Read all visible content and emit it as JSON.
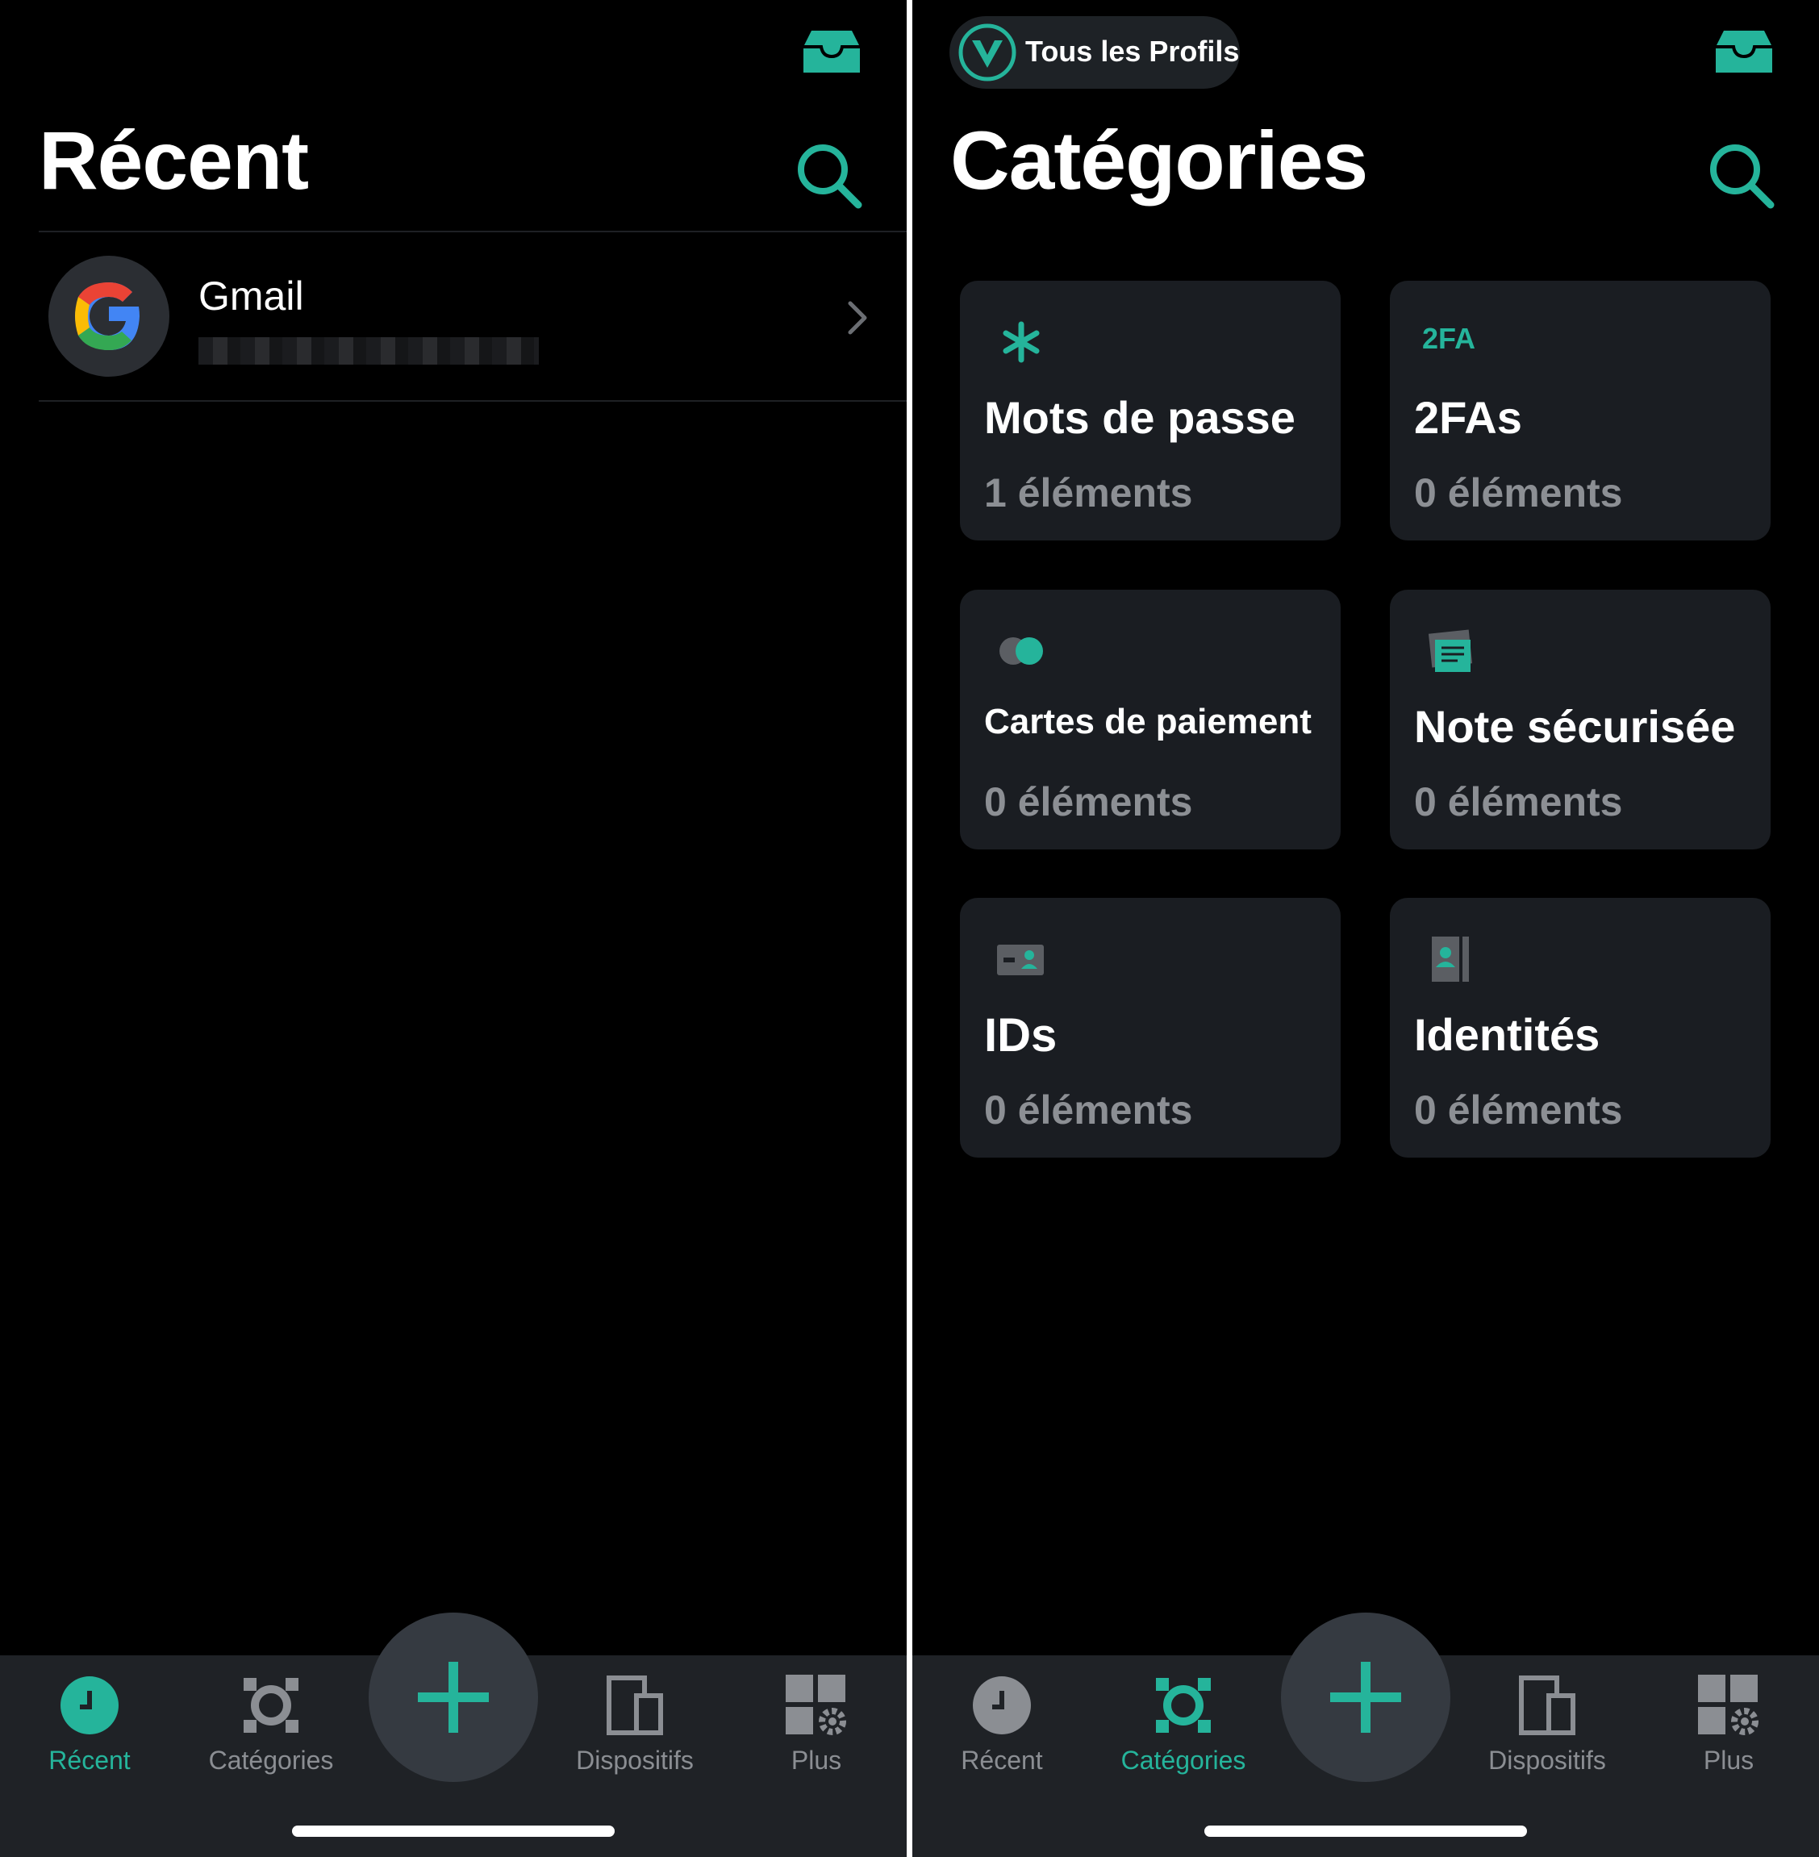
{
  "left": {
    "title": "Récent",
    "items": [
      {
        "name": "Gmail"
      }
    ]
  },
  "right": {
    "profile_label": "Tous les Profils",
    "title": "Catégories",
    "cards": [
      {
        "icon": "asterisk-icon",
        "title": "Mots de passe",
        "count": "1 éléments"
      },
      {
        "icon": "2fa-tag",
        "tag": "2FA",
        "title": "2FAs",
        "count": "0 éléments"
      },
      {
        "icon": "payment-cards-icon",
        "title": "Cartes de paiement",
        "count": "0 éléments"
      },
      {
        "icon": "secure-note-icon",
        "title": "Note sécurisée",
        "count": "0 éléments"
      },
      {
        "icon": "id-card-icon",
        "title": "IDs",
        "count": "0 éléments"
      },
      {
        "icon": "identity-icon",
        "title": "Identités",
        "count": "0 éléments"
      }
    ]
  },
  "tabs": [
    "Récent",
    "Catégories",
    "Dispositifs",
    "Plus"
  ],
  "colors": {
    "accent": "#25b49b",
    "background": "#000000",
    "card": "#1a1d22",
    "tabbar": "#1f2226",
    "muted": "#8c8f94"
  }
}
